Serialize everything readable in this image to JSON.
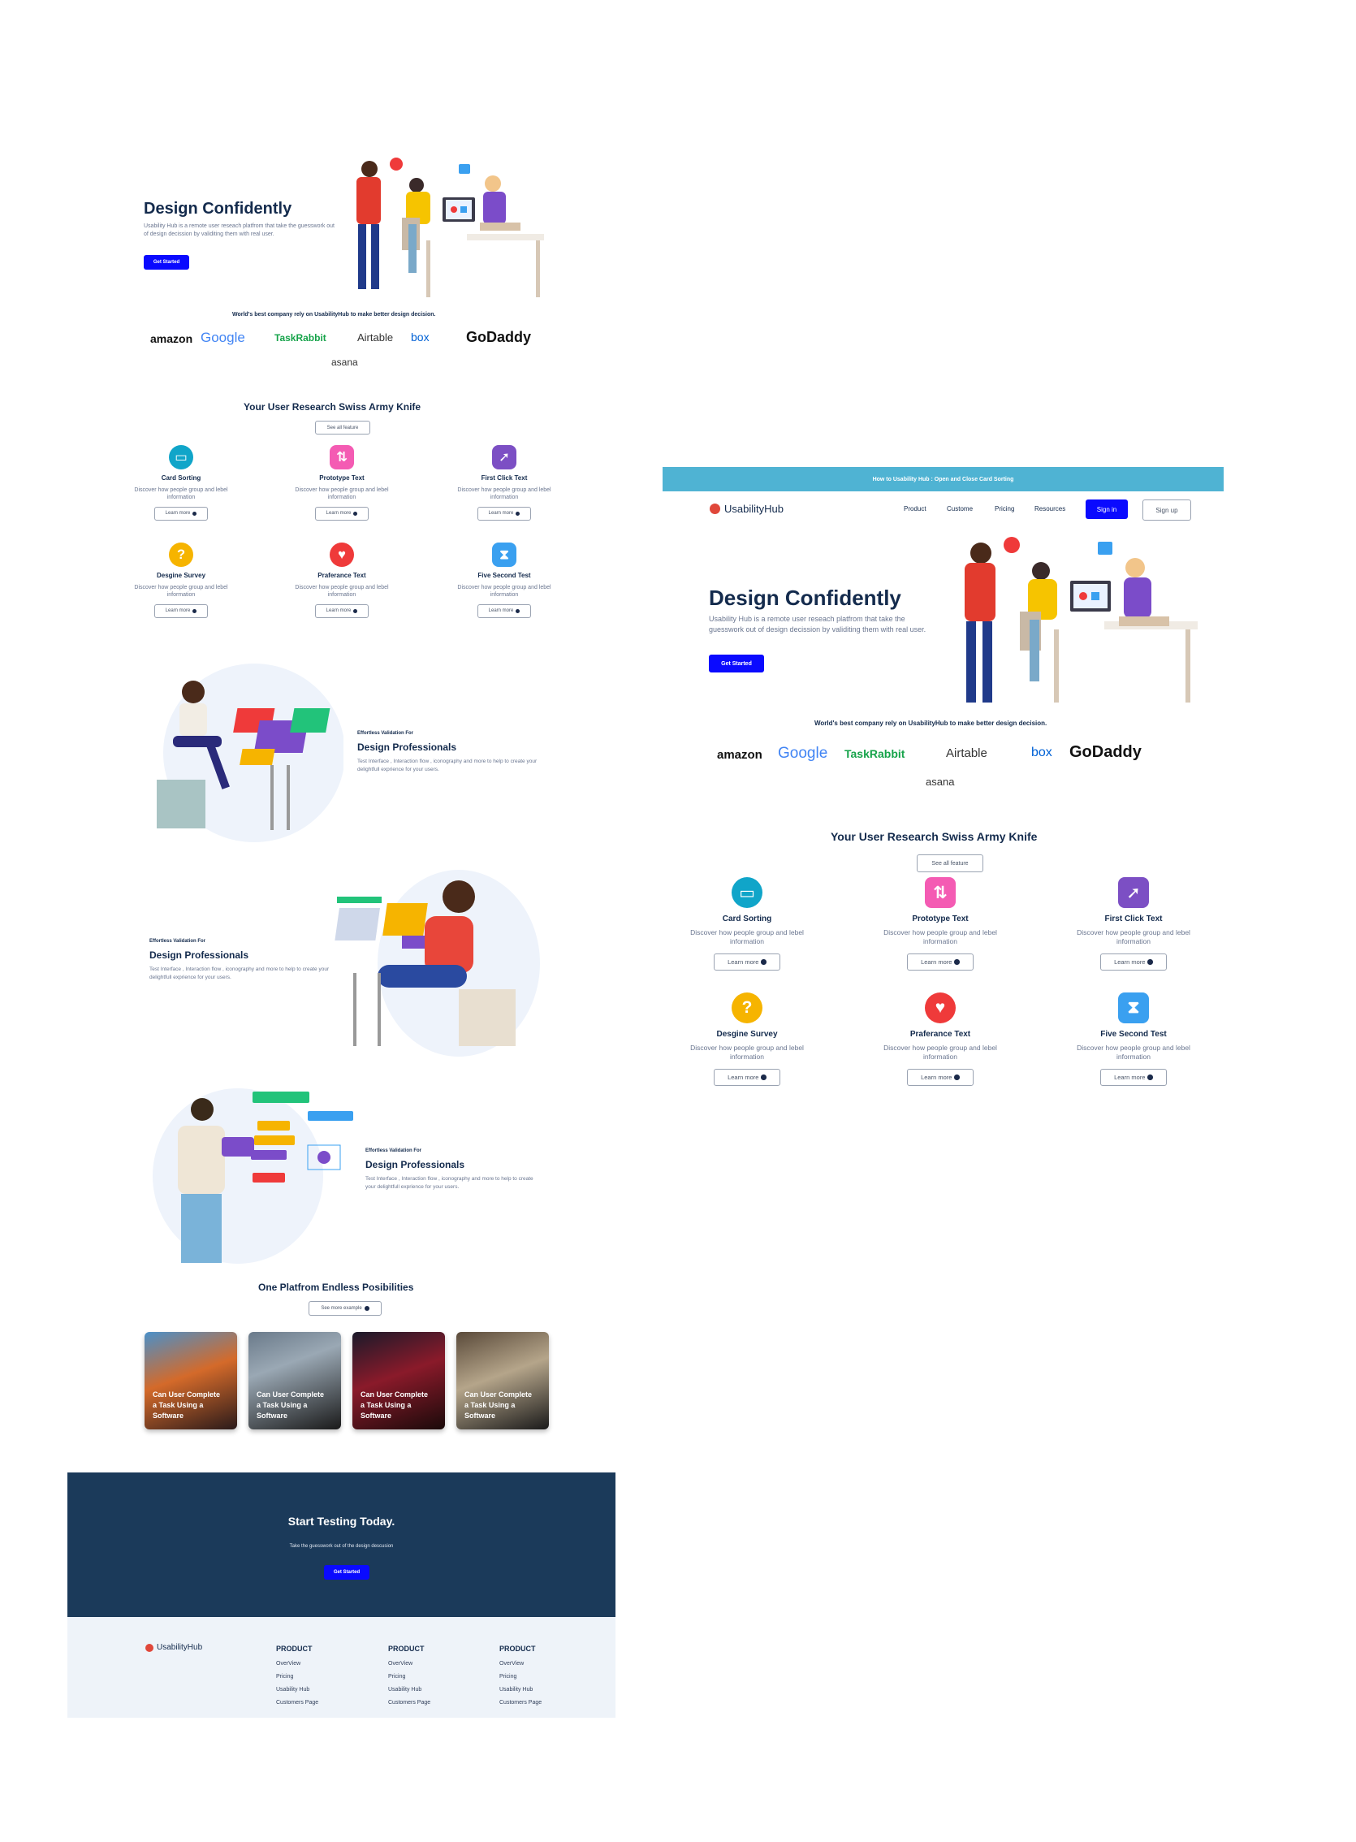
{
  "left": {
    "hero": {
      "title": "Design Confidently",
      "subtitle": "Usability Hub is a remote user reseach platfrom that take the guesswork out of design decission by validiting them with real user.",
      "cta": "Get Started"
    },
    "trust_text": "World's best company rely on UsabilityHub to make better design decision.",
    "logos": [
      "amazon",
      "Google",
      "TaskRabbit",
      "Airtable",
      "box",
      "GoDaddy",
      "asana"
    ],
    "features_title": "Your User Research Swiss Army Knife",
    "features_button": "See all feature",
    "features": [
      {
        "title": "Card Sorting",
        "desc": "Discover how people group and lebel information",
        "link": "Learn more",
        "icon": "card-sorting-icon",
        "color": "#10a5c9"
      },
      {
        "title": "Prototype Text",
        "desc": "Discover how people group and lebel information",
        "link": "Learn more",
        "icon": "prototype-icon",
        "color": "#f45bb3"
      },
      {
        "title": "First Click Text",
        "desc": "Discover how people group and lebel information",
        "link": "Learn more",
        "icon": "cursor-icon",
        "color": "#7c4fc4"
      },
      {
        "title": "Desgine Survey",
        "desc": "Discover how people group and lebel information",
        "link": "Learn more",
        "icon": "question-icon",
        "color": "#f6b400"
      },
      {
        "title": "Praferance Text",
        "desc": "Discover how people group and lebel information",
        "link": "Learn more",
        "icon": "heart-icon",
        "color": "#ef3a3a"
      },
      {
        "title": "Five Second Test",
        "desc": "Discover how people group and lebel information",
        "link": "Learn more",
        "icon": "hourglass-icon",
        "color": "#3aa0f0"
      }
    ],
    "validation": [
      {
        "eyebrow": "Effortless Validation For",
        "title": "Design Professionals",
        "desc": "Test Interface , Interaction flow , iconography and more to help to create your delightfull exprience for your users."
      },
      {
        "eyebrow": "Effortless Validation For",
        "title": "Design Professionals",
        "desc": "Test Interface , Interaction flow , iconography and more to help to create your delightfull exprience for your users."
      },
      {
        "eyebrow": "Effortless Validation For",
        "title": "Design Professionals",
        "desc": "Test Interface , Interaction flow , iconography and more to help to create your delightfull exprience for your users."
      }
    ],
    "platform_title": "One Platfrom Endless Posibilities",
    "platform_button": "See more example",
    "cases": [
      {
        "title": "Can User Complete a Task Using a Software"
      },
      {
        "title": "Can User Complete a Task Using a Software"
      },
      {
        "title": "Can User Complete a Task Using a Software"
      },
      {
        "title": "Can User Complete a Task Using a Software"
      }
    ],
    "cta_section": {
      "title": "Start Testing Today.",
      "subtitle": "Take the guesswork out of the design descusion",
      "button": "Get Started"
    },
    "footer": {
      "brand": "UsabilityHub",
      "columns": [
        {
          "heading": "PRODUCT",
          "links": [
            "OverView",
            "Pricing",
            "Usability Hub",
            "Customers Page"
          ]
        },
        {
          "heading": "PRODUCT",
          "links": [
            "OverView",
            "Pricing",
            "Usability Hub",
            "Customers Page"
          ]
        },
        {
          "heading": "PRODUCT",
          "links": [
            "OverView",
            "Pricing",
            "Usability Hub",
            "Customers Page"
          ]
        }
      ]
    }
  },
  "right": {
    "banner": "How to Usability Hub : Open and Close Card Sorting",
    "brand": "UsabilityHub",
    "nav": [
      "Product",
      "Custome",
      "Pricing",
      "Resources"
    ],
    "sign_in": "Sign in",
    "sign_up": "Sign up",
    "hero": {
      "title": "Design Confidently",
      "subtitle": "Usability Hub is a remote user reseach platfrom that take the guesswork out of design decission by validiting them with real user.",
      "cta": "Get Started"
    },
    "trust_text": "World's best company rely on UsabilityHub to make better design decision.",
    "features_title": "Your User Research Swiss Army Knife",
    "features_button": "See all feature"
  },
  "colors": {
    "navy": "#1b3a5a",
    "blue": "#0a0aff",
    "banner": "#4fb3d3",
    "footer_bg": "#eef3f9"
  }
}
